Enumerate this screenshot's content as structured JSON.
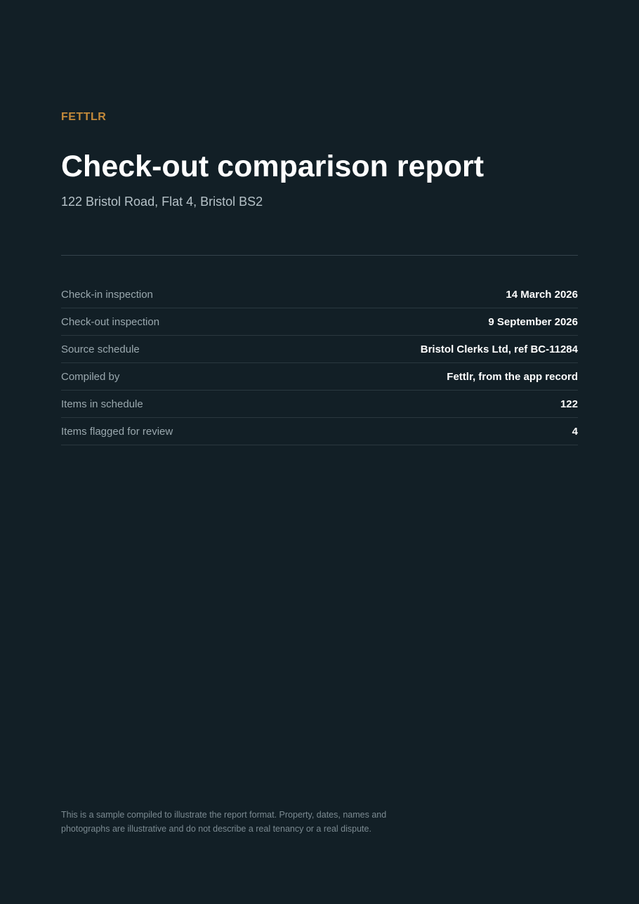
{
  "brand": "FETTLR",
  "title": "Check-out comparison report",
  "address": "122 Bristol Road, Flat 4, Bristol BS2",
  "details": [
    {
      "label": "Check-in inspection",
      "value": "14 March 2026"
    },
    {
      "label": "Check-out inspection",
      "value": "9 September 2026"
    },
    {
      "label": "Source schedule",
      "value": "Bristol Clerks Ltd, ref BC-11284"
    },
    {
      "label": "Compiled by",
      "value": "Fettlr, from the app record"
    },
    {
      "label": "Items in schedule",
      "value": "122"
    },
    {
      "label": "Items flagged for review",
      "value": "4"
    }
  ],
  "footnote": "This is a sample compiled to illustrate the report format. Property, dates, names and photographs are illustrative and do not describe a real tenancy or a real dispute.",
  "colors": {
    "background": "#121f26",
    "accent": "#c48a3a",
    "text_primary": "#ffffff",
    "text_secondary": "#9aa8ae"
  }
}
